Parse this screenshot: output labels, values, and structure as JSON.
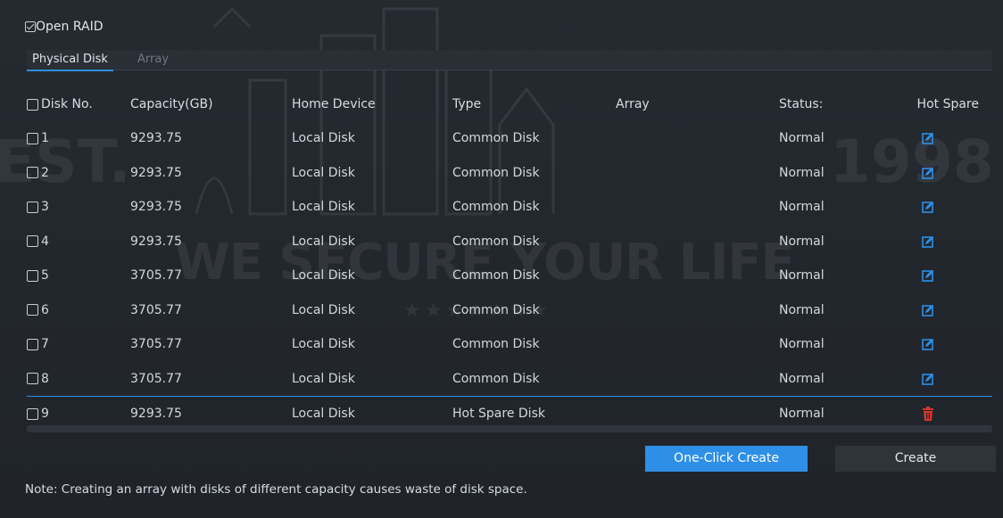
{
  "open_raid": {
    "label": "Open RAID",
    "checked": true
  },
  "tabs": [
    {
      "label": "Physical Disk",
      "active": true
    },
    {
      "label": "Array",
      "active": false
    }
  ],
  "table": {
    "headers": {
      "disk_no": "Disk No.",
      "capacity": "Capacity(GB)",
      "home_device": "Home Device",
      "type": "Type",
      "array": "Array",
      "status": "Status:",
      "hot_spare": "Hot Spare"
    },
    "rows": [
      {
        "disk_no": "1",
        "capacity": "9293.75",
        "home_device": "Local Disk",
        "type": "Common Disk",
        "array": "",
        "status": "Normal",
        "hot_spare_icon": "edit-icon"
      },
      {
        "disk_no": "2",
        "capacity": "9293.75",
        "home_device": "Local Disk",
        "type": "Common Disk",
        "array": "",
        "status": "Normal",
        "hot_spare_icon": "edit-icon"
      },
      {
        "disk_no": "3",
        "capacity": "9293.75",
        "home_device": "Local Disk",
        "type": "Common Disk",
        "array": "",
        "status": "Normal",
        "hot_spare_icon": "edit-icon"
      },
      {
        "disk_no": "4",
        "capacity": "9293.75",
        "home_device": "Local Disk",
        "type": "Common Disk",
        "array": "",
        "status": "Normal",
        "hot_spare_icon": "edit-icon"
      },
      {
        "disk_no": "5",
        "capacity": "3705.77",
        "home_device": "Local Disk",
        "type": "Common Disk",
        "array": "",
        "status": "Normal",
        "hot_spare_icon": "edit-icon"
      },
      {
        "disk_no": "6",
        "capacity": "3705.77",
        "home_device": "Local Disk",
        "type": "Common Disk",
        "array": "",
        "status": "Normal",
        "hot_spare_icon": "edit-icon"
      },
      {
        "disk_no": "7",
        "capacity": "3705.77",
        "home_device": "Local Disk",
        "type": "Common Disk",
        "array": "",
        "status": "Normal",
        "hot_spare_icon": "edit-icon"
      },
      {
        "disk_no": "8",
        "capacity": "3705.77",
        "home_device": "Local Disk",
        "type": "Common Disk",
        "array": "",
        "status": "Normal",
        "hot_spare_icon": "edit-icon"
      },
      {
        "disk_no": "9",
        "capacity": "9293.75",
        "home_device": "Local Disk",
        "type": "Hot Spare Disk",
        "array": "",
        "status": "Normal",
        "hot_spare_icon": "delete-icon"
      }
    ]
  },
  "buttons": {
    "one_click_create": "One-Click Create",
    "create": "Create"
  },
  "note": "Note: Creating an array with disks of different capacity causes waste of disk space.",
  "watermark": {
    "left": "EST.",
    "middle": "WE SECURE YOUR LIFE",
    "right": "1998",
    "stars": "★★★★★★★"
  },
  "colors": {
    "accent": "#2e8fe6",
    "edit_icon": "#2e8fe6",
    "delete_icon": "#d9342b",
    "background": "#23272e"
  }
}
